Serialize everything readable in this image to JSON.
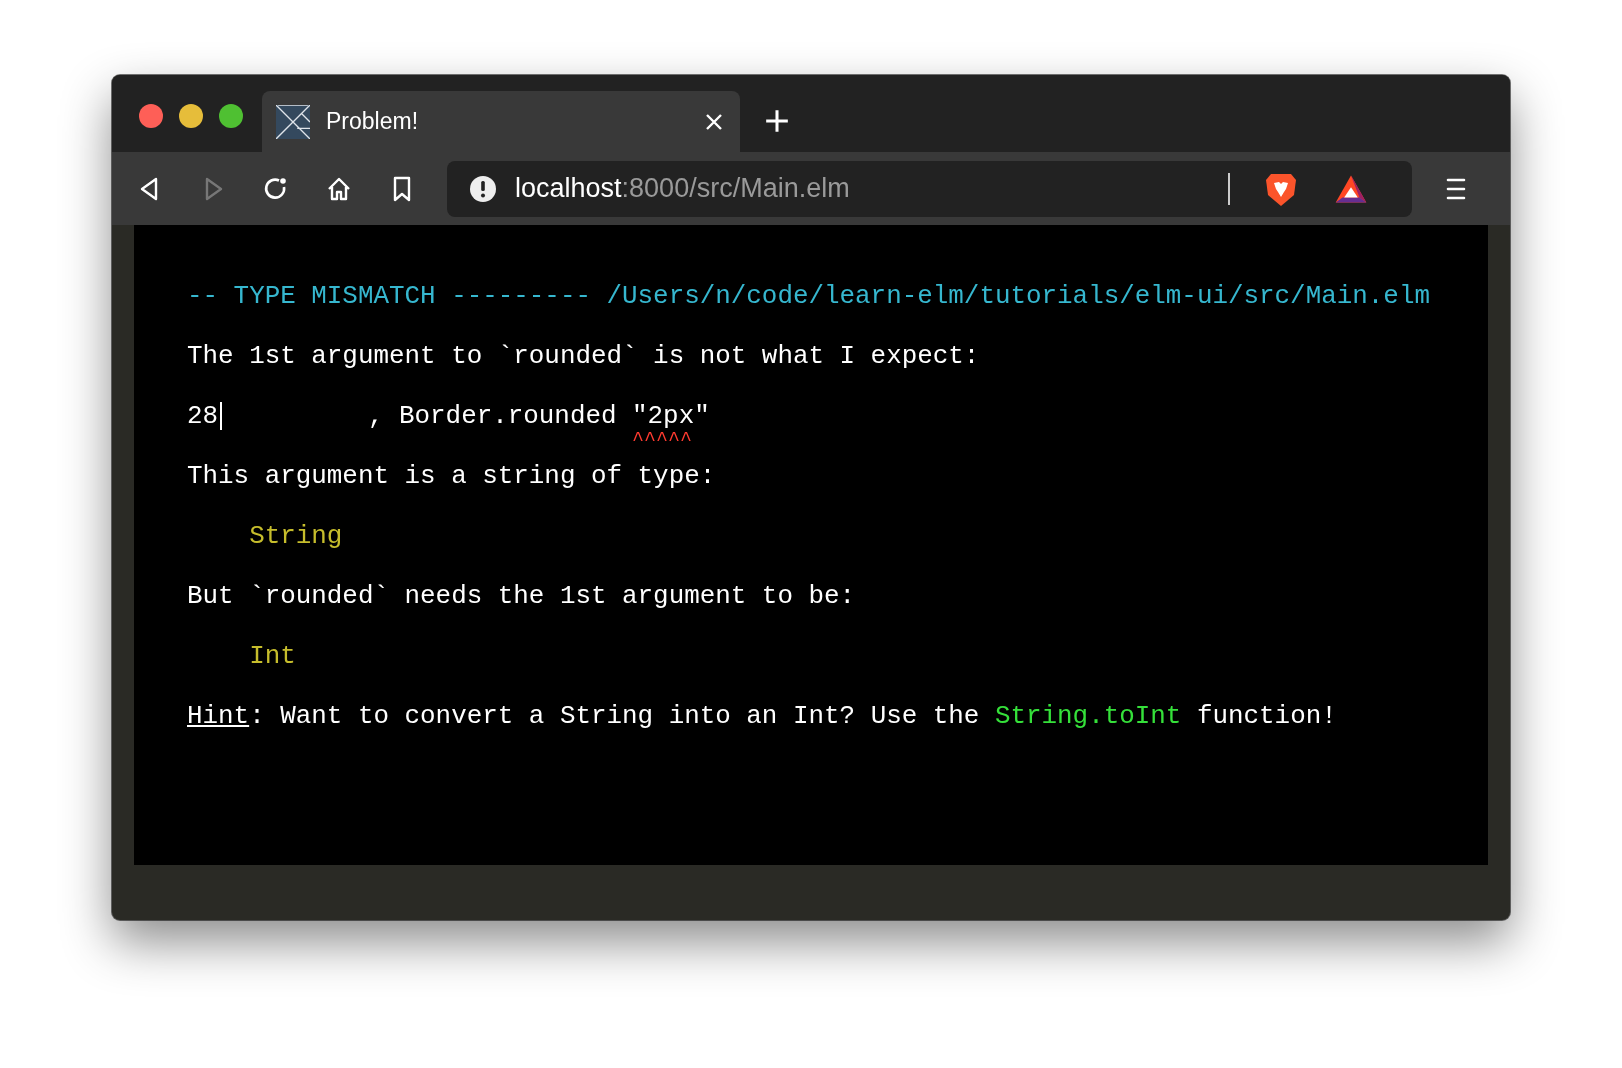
{
  "tabs": [
    {
      "title": "Problem!",
      "selected": true
    }
  ],
  "toolbar": {
    "back_disabled": false,
    "forward_disabled": true
  },
  "address_bar": {
    "host": "localhost",
    "path": ":8000/src/Main.elm"
  },
  "message": [
    {
      "kind": "header",
      "text": "-- TYPE MISMATCH --------- /Users/n/code/learn-elm/tutorials/elm-ui/src/Main.elm"
    },
    {
      "kind": "text",
      "text": "The 1st argument to `rounded` is not what I expect:"
    },
    {
      "kind": "code",
      "line_number": "28",
      "code": "         , Border.rounded ",
      "argument": "\"2px\"",
      "underline": "^^^^^"
    },
    {
      "kind": "text",
      "text": "This argument is a string of type:"
    },
    {
      "kind": "type",
      "text": "String"
    },
    {
      "kind": "text",
      "text": "But `rounded` needs the 1st argument to be:"
    },
    {
      "kind": "type",
      "text": "Int"
    },
    {
      "kind": "hint",
      "parts": [
        {
          "kind": "underlined",
          "text": "Hint"
        },
        {
          "kind": "plain",
          "text": ": Want to convert a String into an Int? Use the "
        },
        {
          "kind": "green",
          "text": "String.toInt"
        },
        {
          "kind": "plain",
          "text": " function!"
        }
      ]
    }
  ]
}
